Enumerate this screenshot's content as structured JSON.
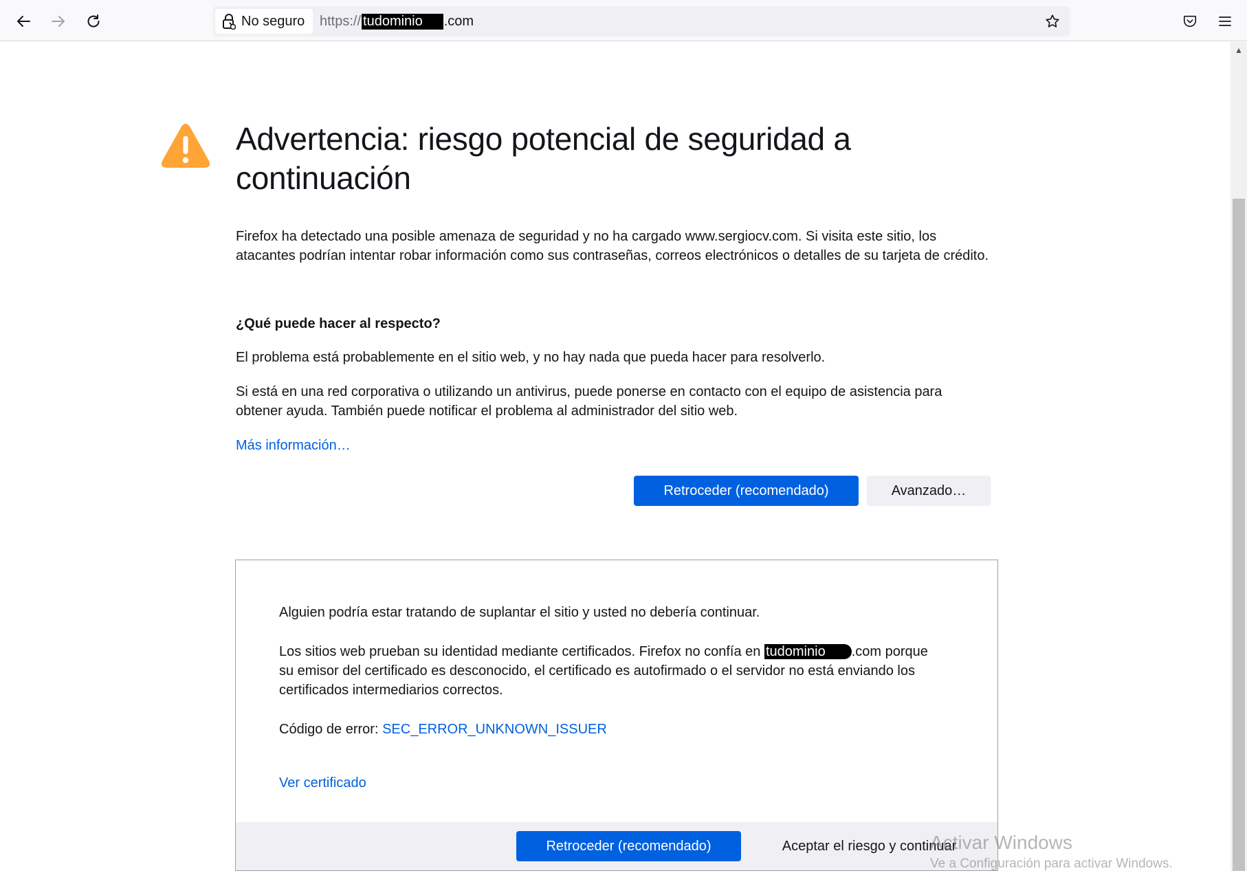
{
  "toolbar": {
    "back_icon": "arrow-left-icon",
    "forward_icon": "arrow-right-icon",
    "reload_icon": "reload-icon",
    "identity_label": "No seguro",
    "url_scheme": "https://",
    "url_domain_redacted": "tudominio",
    "url_tld": ".com",
    "bookmark_icon": "star-icon",
    "pocket_icon": "pocket-icon",
    "menu_icon": "hamburger-menu-icon"
  },
  "page": {
    "title": "Advertencia: riesgo potencial de seguridad a continuación",
    "intro": "Firefox ha detectado una posible amenaza de seguridad y no ha cargado www.sergiocv.com. Si visita este sitio, los atacantes podrían intentar robar información como sus contraseñas, correos electrónicos o detalles de su tarjeta de crédito.",
    "what_heading": "¿Qué puede hacer al respecto?",
    "what_p1": "El problema está probablemente en el sitio web, y no hay nada que pueda hacer para resolverlo.",
    "what_p2": "Si está en una red corporativa o utilizando un antivirus, puede ponerse en contacto con el equipo de asistencia para obtener ayuda. También puede notificar el problema al administrador del sitio web.",
    "learn_more": "Más información…",
    "go_back_button": "Retroceder (recomendado)",
    "advanced_button": "Avanzado…"
  },
  "advanced": {
    "p1": "Alguien podría estar tratando de suplantar el sitio y usted no debería continuar.",
    "p2_before": "Los sitios web prueban su identidad mediante certificados. Firefox no confía en ",
    "p2_domain_redacted": "tudominio",
    "p2_after": ".com porque su emisor del certificado es desconocido, el certificado es autofirmado o el servidor no está enviando los certificados intermediarios correctos.",
    "error_label": "Código de error: ",
    "error_code": "SEC_ERROR_UNKNOWN_ISSUER",
    "view_certificate": "Ver certificado",
    "go_back_button": "Retroceder (recomendado)",
    "accept_button": "Aceptar el riesgo y continuar"
  },
  "watermark": {
    "line1": "Activar Windows",
    "line2": "Ve a Configuración para activar Windows."
  },
  "colors": {
    "accent": "#0061e0",
    "warning": "#ffa436"
  }
}
